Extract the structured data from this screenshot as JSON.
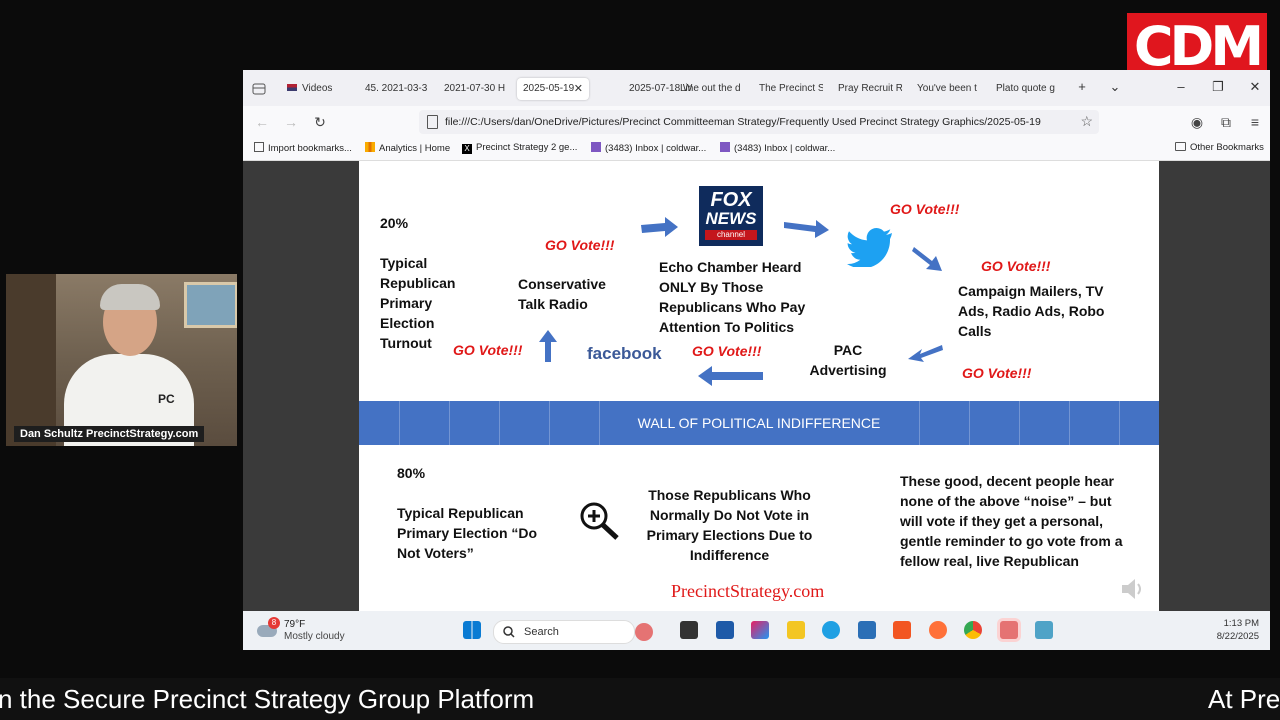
{
  "logo": {
    "text": "CDM"
  },
  "webcam": {
    "name_label": "Dan Schultz PrecinctStrategy.com",
    "shirt_text": "PC"
  },
  "browser": {
    "tabs": [
      {
        "label": "Videos"
      },
      {
        "label": "45. 2021-03-3"
      },
      {
        "label": "2021-07-30 H"
      },
      {
        "label": "2025-05-19",
        "active": true
      },
      {
        "label": "2025-07-18 W"
      },
      {
        "label": "Line out the d"
      },
      {
        "label": "The Precinct S"
      },
      {
        "label": "Pray Recruit R"
      },
      {
        "label": "You've been t"
      },
      {
        "label": "Plato quote g"
      }
    ],
    "url": "file:///C:/Users/dan/OneDrive/Pictures/Precinct Committeeman Strategy/Frequently Used Precinct Strategy Graphics/2025-05-19",
    "bookmarks": [
      "Import bookmarks...",
      "Analytics | Home",
      "Precinct Strategy 2 ge...",
      "(3483) Inbox | coldwar...",
      "(3483) Inbox | coldwar..."
    ],
    "other_bookmarks": "Other Bookmarks"
  },
  "slide": {
    "top_pct": "20%",
    "top_left_label": "Typical Republican Primary Election Turnout",
    "talk_radio": "Conservative Talk Radio",
    "echo_chamber": "Echo Chamber Heard ONLY By Those Republicans Who Pay Attention To Politics",
    "campaign": "Campaign Mailers, TV Ads, Radio Ads, Robo Calls",
    "pac": "PAC Advertising",
    "go_vote": "GO Vote!!!",
    "facebook": "facebook",
    "fox_line1": "FOX",
    "fox_line2": "NEWS",
    "fox_line3": "channel",
    "wall": "WALL OF POLITICAL INDIFFERENCE",
    "bottom_pct": "80%",
    "bottom_left_label": "Typical Republican Primary Election “Do Not Voters”",
    "those_republicans": "Those Republicans Who Normally Do Not Vote in Primary Elections Due to Indifference",
    "good_people": "These good, decent people hear none of the above “noise” – but will vote if they get a personal, gentle reminder to go vote from a fellow real, live Republican",
    "site": "PrecinctStrategy.com"
  },
  "taskbar": {
    "weather_badge": "8",
    "temp": "79°F",
    "condition": "Mostly cloudy",
    "search_placeholder": "Search",
    "time": "1:13 PM",
    "date": "8/22/2025"
  },
  "ticker": {
    "left_text": "n the Secure Precinct Strategy Group Platform",
    "right_text": "At Pre"
  },
  "colors": {
    "brand_red": "#e0161e",
    "wall_blue": "#4472c4",
    "go_vote_red": "#e01818",
    "arrow_blue": "#4472c4"
  }
}
